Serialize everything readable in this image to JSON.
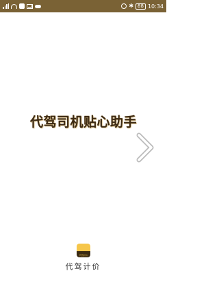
{
  "status_bar": {
    "time": "10:34",
    "battery": "88",
    "icons": [
      "signal-icon",
      "wifi-icon",
      "app-icon",
      "mail-icon",
      "cloud-icon",
      "alarm-icon",
      "bluetooth-icon",
      "battery-icon"
    ]
  },
  "splash": {
    "headline": "代驾司机贴心助手",
    "next_icon": "chevron-right-icon"
  },
  "brand": {
    "logo_text": "代驾计价",
    "name": "代驾计价",
    "logo_colors": {
      "top": "#f6c64a",
      "bottom": "#3a2a12"
    }
  },
  "colors": {
    "status_bar_bg": "#7a6235",
    "headline": "#3c2a14"
  }
}
